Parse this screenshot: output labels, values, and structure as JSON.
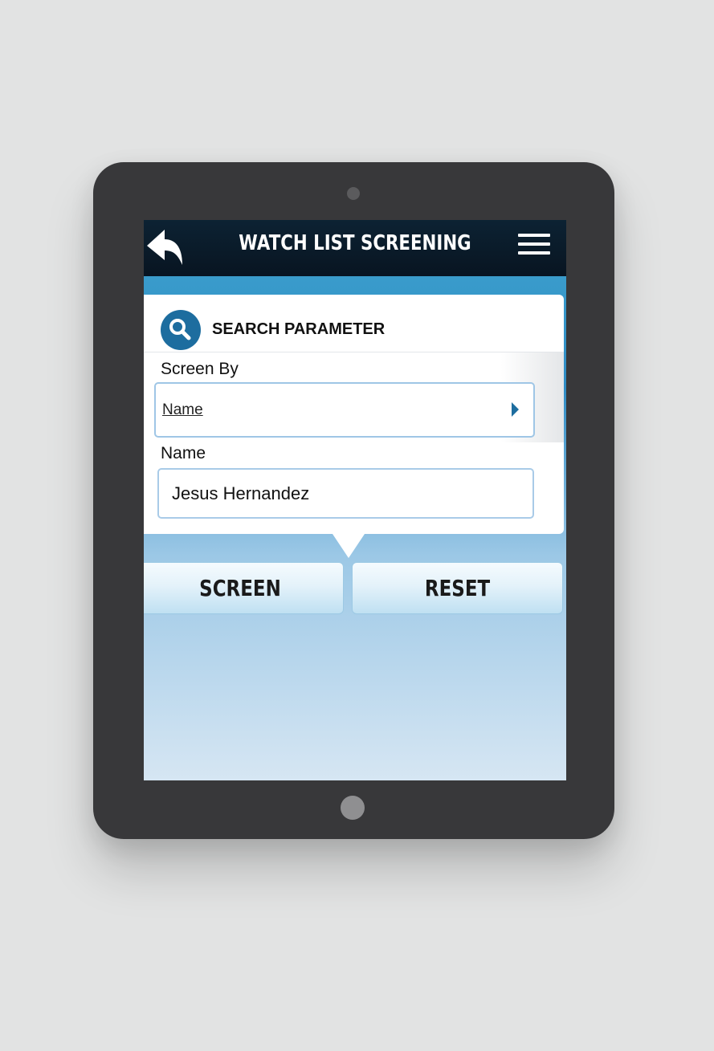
{
  "header": {
    "title": "WATCH LIST SCREENING",
    "back_icon": "back-arrow-icon",
    "menu_icon": "hamburger-menu-icon"
  },
  "panel": {
    "title": "SEARCH PARAMETER",
    "icon": "search-icon",
    "screen_by_label": "Screen By",
    "screen_by_value": "Name",
    "name_label": "Name",
    "name_value": "Jesus Hernandez"
  },
  "actions": {
    "screen_label": "SCREEN",
    "reset_label": "RESET"
  },
  "colors": {
    "header_bg": "#0a1a28",
    "accent": "#1d6d9f",
    "device": "#38383a"
  }
}
